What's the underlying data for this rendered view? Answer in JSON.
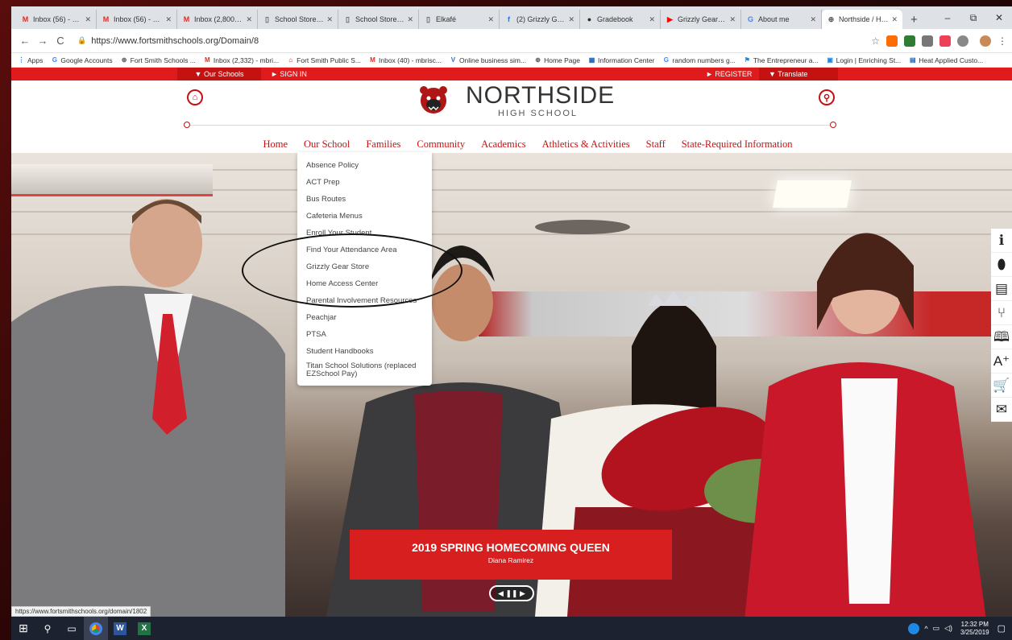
{
  "browser": {
    "tabs": [
      {
        "label": "Inbox (56) - gra...",
        "icon": "gmail-icon",
        "color": "#d93025"
      },
      {
        "label": "Inbox (56) - gra...",
        "icon": "gmail-icon",
        "color": "#d93025"
      },
      {
        "label": "Inbox (2,800) - m...",
        "icon": "gmail-icon",
        "color": "#d93025"
      },
      {
        "label": "School Store Pos...",
        "icon": "doc-icon",
        "color": "#666"
      },
      {
        "label": "School Store Ma...",
        "icon": "doc-icon",
        "color": "#666"
      },
      {
        "label": "Elkafé",
        "icon": "doc-icon",
        "color": "#666"
      },
      {
        "label": "(2) Grizzly Gear ...",
        "icon": "facebook-icon",
        "color": "#1877f2"
      },
      {
        "label": "Gradebook",
        "icon": "gradebook-icon",
        "color": "#3b2a1a"
      },
      {
        "label": "Grizzly Gear - Yo...",
        "icon": "youtube-icon",
        "color": "#ff0000"
      },
      {
        "label": "About me",
        "icon": "google-icon",
        "color": "#4285f4"
      },
      {
        "label": "Northside / Hom...",
        "icon": "globe-icon",
        "color": "#555",
        "active": true
      }
    ],
    "new_tab": "+",
    "window_controls": {
      "minimize": "–",
      "restore": "⧉",
      "close": "✕"
    },
    "nav": {
      "back": "←",
      "forward": "→",
      "reload": "C"
    },
    "url": "https://www.fortsmithschools.org/Domain/8",
    "bookmarks": [
      {
        "label": "Apps",
        "icon": "apps-icon"
      },
      {
        "label": "Google Accounts",
        "icon": "google-icon"
      },
      {
        "label": "Fort Smith Schools ...",
        "icon": "globe-icon"
      },
      {
        "label": "Inbox (2,332) - mbri...",
        "icon": "gmail-icon"
      },
      {
        "label": "Fort Smith Public S...",
        "icon": "school-icon"
      },
      {
        "label": "Inbox (40) - mbrisc...",
        "icon": "gmail-icon"
      },
      {
        "label": "Online business sim...",
        "icon": "v-icon"
      },
      {
        "label": "Home Page",
        "icon": "globe-icon"
      },
      {
        "label": "Information Center",
        "icon": "info-icon"
      },
      {
        "label": "random numbers g...",
        "icon": "google-icon"
      },
      {
        "label": "The Entrepreneur a...",
        "icon": "flag-icon"
      },
      {
        "label": "Login | Enriching St...",
        "icon": "login-icon"
      },
      {
        "label": "Heat Applied Custo...",
        "icon": "doc-icon"
      }
    ]
  },
  "site": {
    "util": {
      "our_schools": "▼ Our Schools",
      "sign_in": "► SIGN IN",
      "register": "► REGISTER",
      "translate": "▼ Translate"
    },
    "school_name": "NORTHSIDE",
    "school_sub": "HIGH SCHOOL",
    "nav": [
      "Home",
      "Our School",
      "Families",
      "Community",
      "Academics",
      "Athletics & Activities",
      "Staff",
      "State-Required Information"
    ],
    "families_menu": [
      "Absence Policy",
      "ACT Prep",
      "Bus Routes",
      "Cafeteria Menus",
      "Enroll Your Student",
      "Find Your Attendance Area",
      "Grizzly Gear Store",
      "Home Access Center",
      "Parental Involvement Resources",
      "Peachjar",
      "PTSA",
      "Student Handbooks",
      "Titan School Solutions (replaced EZSchool Pay)"
    ],
    "hero": {
      "caption_title": "2019 SPRING HOMECOMING QUEEN",
      "caption_sub": "Diana Ramirez",
      "slider_controls": "◀ ❚❚ ▶"
    },
    "side_icons": [
      "info-icon",
      "mouse-icon",
      "calculator-icon",
      "utensils-icon",
      "book-icon",
      "grade-icon",
      "cart-icon",
      "mail-icon"
    ],
    "status_url": "https://www.fortsmithschools.org/domain/1802"
  },
  "taskbar": {
    "clock_time": "12:32 PM",
    "clock_date": "3/25/2019"
  }
}
